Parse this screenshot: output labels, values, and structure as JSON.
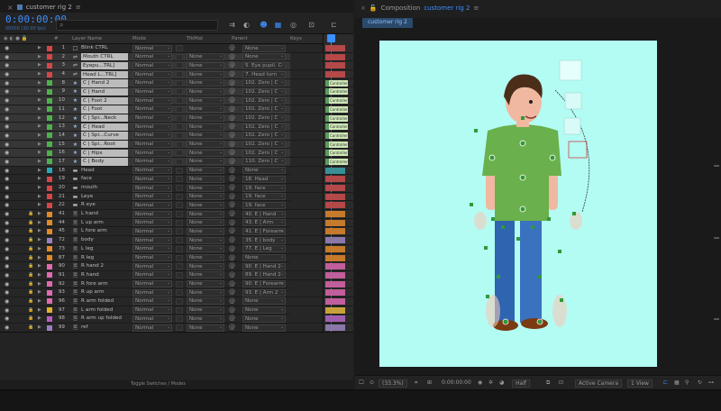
{
  "timeline": {
    "tab_title": "customer rig 2",
    "timecode": "0:00:00:00",
    "fps": "00000 (30.00 fps)",
    "search_placeholder": "⌕",
    "columns": {
      "source_name": "Layer Name",
      "mode": "Mode",
      "trkmat": "TrkMat",
      "parent": "Parent",
      "keys": "Keys"
    },
    "footer_label": "Toggle Switches / Modes"
  },
  "layers": [
    {
      "num": "1",
      "name": "Blink CTRL",
      "type": "null",
      "mode": "Normal",
      "trk": "",
      "parent": "None",
      "label": "#d64646",
      "hl": false,
      "star": false
    },
    {
      "num": "2",
      "name": "Mouth CTRL",
      "type": "ctrl",
      "mode": "Normal",
      "trk": "None",
      "parent": "None",
      "label": "#d64646",
      "hl": true,
      "star": false
    },
    {
      "num": "3",
      "name": "Eyepu...TRL]",
      "type": "ctrl",
      "mode": "Normal",
      "trk": "None",
      "parent": "5. Eye pupil. C",
      "label": "#d64646",
      "hl": true,
      "star": false
    },
    {
      "num": "4",
      "name": "Head L...TRL]",
      "type": "ctrl",
      "mode": "Normal",
      "trk": "None",
      "parent": "7. Head turn",
      "label": "#d64646",
      "hl": true,
      "star": false
    },
    {
      "num": "8",
      "name": "C | Hand 2",
      "type": "star",
      "mode": "Normal",
      "trk": "None",
      "parent": "102. Zero | C",
      "label": "#4db04d",
      "hl": true,
      "star": true
    },
    {
      "num": "9",
      "name": "C | Hand",
      "type": "star",
      "mode": "Normal",
      "trk": "None",
      "parent": "102. Zero | C",
      "label": "#4db04d",
      "hl": true,
      "star": true
    },
    {
      "num": "10",
      "name": "C | Foot 2",
      "type": "star",
      "mode": "Normal",
      "trk": "None",
      "parent": "102. Zero | C",
      "label": "#4db04d",
      "hl": true,
      "star": true
    },
    {
      "num": "11",
      "name": "C | Foot",
      "type": "star",
      "mode": "Normal",
      "trk": "None",
      "parent": "102. Zero | C",
      "label": "#4db04d",
      "hl": true,
      "star": true
    },
    {
      "num": "12",
      "name": "C | Spi...Neck",
      "type": "star",
      "mode": "Normal",
      "trk": "None",
      "parent": "102. Zero | C",
      "label": "#4db04d",
      "hl": true,
      "star": true
    },
    {
      "num": "13",
      "name": "C | Head",
      "type": "star",
      "mode": "Normal",
      "trk": "None",
      "parent": "102. Zero | C",
      "label": "#4db04d",
      "hl": true,
      "star": true
    },
    {
      "num": "14",
      "name": "C | Spi...Curve",
      "type": "star",
      "mode": "Normal",
      "trk": "None",
      "parent": "102. Zero | C",
      "label": "#4db04d",
      "hl": true,
      "star": true
    },
    {
      "num": "15",
      "name": "C | Spi...Root",
      "type": "star",
      "mode": "Normal",
      "trk": "None",
      "parent": "102. Zero | C",
      "label": "#4db04d",
      "hl": true,
      "star": true
    },
    {
      "num": "16",
      "name": "C | Hips",
      "type": "star",
      "mode": "Normal",
      "trk": "None",
      "parent": "102. Zero | C",
      "label": "#4db04d",
      "hl": true,
      "star": true
    },
    {
      "num": "17",
      "name": "C | Body",
      "type": "star",
      "mode": "Normal",
      "trk": "None",
      "parent": "110. Zero | C",
      "label": "#4db04d",
      "hl": true,
      "star": true
    },
    {
      "num": "18",
      "name": "Head",
      "type": "solid",
      "mode": "Normal",
      "trk": "None",
      "parent": "None",
      "label": "#2aa7b8",
      "hl": false,
      "star": false
    },
    {
      "num": "19",
      "name": "face",
      "type": "solid",
      "mode": "Normal",
      "trk": "None",
      "parent": "18. Head",
      "label": "#d64646",
      "hl": false,
      "star": false
    },
    {
      "num": "20",
      "name": "mouth",
      "type": "solid",
      "mode": "Normal",
      "trk": "None",
      "parent": "19. face",
      "label": "#d64646",
      "hl": false,
      "star": false
    },
    {
      "num": "21",
      "name": "Leye",
      "type": "solid",
      "mode": "Normal",
      "trk": "None",
      "parent": "19. face",
      "label": "#d64646",
      "hl": false,
      "star": false
    },
    {
      "num": "22",
      "name": "R eye",
      "type": "solid",
      "mode": "Normal",
      "trk": "None",
      "parent": "19. face",
      "label": "#d64646",
      "hl": false,
      "star": false
    },
    {
      "num": "41",
      "name": "L hand",
      "type": "file",
      "mode": "Normal",
      "trk": "None",
      "parent": "40. E | Hand",
      "label": "#e08a2a",
      "hl": false,
      "star": false
    },
    {
      "num": "44",
      "name": "L up arm",
      "type": "file",
      "mode": "Normal",
      "trk": "None",
      "parent": "43. E | Arm",
      "label": "#e08a2a",
      "hl": false,
      "star": false
    },
    {
      "num": "45",
      "name": "L fore arm",
      "type": "file",
      "mode": "Normal",
      "trk": "None",
      "parent": "41. E | Forearm",
      "label": "#e08a2a",
      "hl": false,
      "star": false
    },
    {
      "num": "72",
      "name": "body",
      "type": "file",
      "mode": "Normal",
      "trk": "None",
      "parent": "35. E | body",
      "label": "#9a7fc0",
      "hl": false,
      "star": false
    },
    {
      "num": "73",
      "name": "L leg",
      "type": "file",
      "mode": "Normal",
      "trk": "None",
      "parent": "77. E | Leg",
      "label": "#e08a2a",
      "hl": false,
      "star": false
    },
    {
      "num": "87",
      "name": "R leg",
      "type": "file",
      "mode": "Normal",
      "trk": "None",
      "parent": "None",
      "label": "#e08a2a",
      "hl": false,
      "star": false
    },
    {
      "num": "90",
      "name": "R hand 2",
      "type": "file",
      "mode": "Normal",
      "trk": "None",
      "parent": "90. E | Hand 2",
      "label": "#e06bb0",
      "hl": false,
      "star": false
    },
    {
      "num": "91",
      "name": "R hand",
      "type": "file",
      "mode": "Normal",
      "trk": "None",
      "parent": "89. E | Hand 2",
      "label": "#e06bb0",
      "hl": false,
      "star": false
    },
    {
      "num": "92",
      "name": "R fore arm",
      "type": "file",
      "mode": "Normal",
      "trk": "None",
      "parent": "90. E | Forearm",
      "label": "#e06bb0",
      "hl": false,
      "star": false
    },
    {
      "num": "93",
      "name": "R up arm",
      "type": "file",
      "mode": "Normal",
      "trk": "None",
      "parent": "93. E | Arm 2",
      "label": "#e06bb0",
      "hl": false,
      "star": false
    },
    {
      "num": "96",
      "name": "R arm folded",
      "type": "file",
      "mode": "Normal",
      "trk": "None",
      "parent": "None",
      "label": "#e06bb0",
      "hl": false,
      "star": false
    },
    {
      "num": "97",
      "name": "L arm folded",
      "type": "file",
      "mode": "Normal",
      "trk": "None",
      "parent": "None",
      "label": "#e0b42a",
      "hl": false,
      "star": false
    },
    {
      "num": "98",
      "name": "R arm up folded",
      "type": "file",
      "mode": "Normal",
      "trk": "None",
      "parent": "None",
      "label": "#b85ec0",
      "hl": false,
      "star": false
    },
    {
      "num": "99",
      "name": "ref",
      "type": "file",
      "mode": "Normal",
      "trk": "None",
      "parent": "None",
      "label": "#9a7fc0",
      "hl": false,
      "star": false
    }
  ],
  "track_bars": [
    {
      "color": "#b54848",
      "fx": ""
    },
    {
      "color": "#b54848",
      "fx": ""
    },
    {
      "color": "#b54848",
      "fx": ""
    },
    {
      "color": "#b54848",
      "fx": ""
    },
    {
      "color": "#5d9b5d",
      "fx": "Controller"
    },
    {
      "color": "#5d9b5d",
      "fx": "Controller"
    },
    {
      "color": "#5d9b5d",
      "fx": "Controller"
    },
    {
      "color": "#5d9b5d",
      "fx": "Controller"
    },
    {
      "color": "#5d9b5d",
      "fx": "Controller"
    },
    {
      "color": "#5d9b5d",
      "fx": "Controller"
    },
    {
      "color": "#5d9b5d",
      "fx": "Controller"
    },
    {
      "color": "#5d9b5d",
      "fx": "Controller"
    },
    {
      "color": "#5d9b5d",
      "fx": "Controller"
    },
    {
      "color": "#5d9b5d",
      "fx": "Controller"
    },
    {
      "color": "#3a8f97",
      "fx": ""
    },
    {
      "color": "#b54848",
      "fx": ""
    },
    {
      "color": "#b54848",
      "fx": ""
    },
    {
      "color": "#b54848",
      "fx": ""
    },
    {
      "color": "#b54848",
      "fx": ""
    },
    {
      "color": "#c57a2c",
      "fx": ""
    },
    {
      "color": "#c57a2c",
      "fx": ""
    },
    {
      "color": "#c57a2c",
      "fx": ""
    },
    {
      "color": "#8a78a8",
      "fx": ""
    },
    {
      "color": "#c57a2c",
      "fx": ""
    },
    {
      "color": "#c57a2c",
      "fx": ""
    },
    {
      "color": "#c15e9c",
      "fx": ""
    },
    {
      "color": "#c15e9c",
      "fx": ""
    },
    {
      "color": "#c15e9c",
      "fx": ""
    },
    {
      "color": "#c15e9c",
      "fx": ""
    },
    {
      "color": "#c15e9c",
      "fx": ""
    },
    {
      "color": "#c9a13a",
      "fx": ""
    },
    {
      "color": "#a05fae",
      "fx": ""
    },
    {
      "color": "#8a78a8",
      "fx": ""
    }
  ],
  "composition": {
    "panel_label": "Composition",
    "comp_name": "customer rig 2",
    "breadcrumb": "customer rig 2",
    "zoom": "(33.3%)",
    "time": "0:00:00:00",
    "resolution": "Half",
    "camera": "Active Camera",
    "views": "1 View",
    "bg_color": "#b3fcf4"
  },
  "colors": {
    "accent": "#3d8fff",
    "shirt": "#6ab04c",
    "pants": "#2e64b0",
    "skin": "#f0b8a0",
    "hair": "#4a2e1a",
    "shoes": "#7a3a12",
    "handle": "#2f9a3a"
  }
}
